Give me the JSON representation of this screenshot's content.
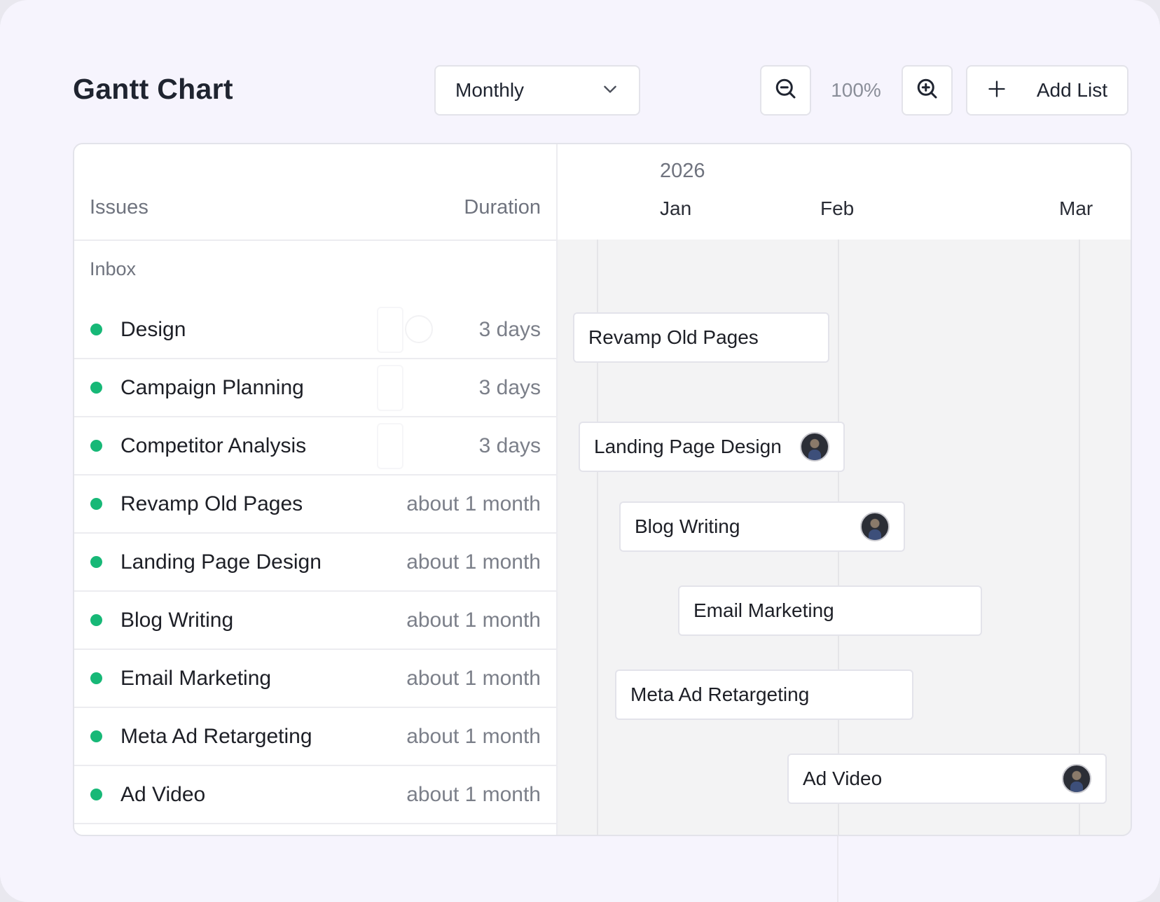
{
  "header": {
    "title": "Gantt Chart",
    "view_select": {
      "value": "Monthly"
    },
    "zoom": {
      "level": "100%"
    },
    "add_list_label": "Add List"
  },
  "issues_table": {
    "columns": {
      "issues": "Issues",
      "duration": "Duration"
    },
    "group": "Inbox",
    "status_color": "#17b877",
    "rows": [
      {
        "name": "Design",
        "duration": "3 days"
      },
      {
        "name": "Campaign Planning",
        "duration": "3 days"
      },
      {
        "name": "Competitor Analysis",
        "duration": "3 days"
      },
      {
        "name": "Revamp Old Pages",
        "duration": "about 1 month"
      },
      {
        "name": "Landing Page Design",
        "duration": "about 1 month"
      },
      {
        "name": "Blog Writing",
        "duration": "about 1 month"
      },
      {
        "name": "Email Marketing",
        "duration": "about 1 month"
      },
      {
        "name": "Meta Ad Retargeting",
        "duration": "about 1 month"
      },
      {
        "name": "Ad Video",
        "duration": "about 1 month"
      }
    ]
  },
  "timeline": {
    "year": "2026",
    "months": [
      "Jan",
      "Feb",
      "Mar"
    ],
    "bars": [
      {
        "label": "Revamp Old Pages",
        "has_avatar": false
      },
      {
        "label": "Landing Page Design",
        "has_avatar": true
      },
      {
        "label": "Blog Writing",
        "has_avatar": true
      },
      {
        "label": "Email Marketing",
        "has_avatar": false
      },
      {
        "label": "Meta Ad Retargeting",
        "has_avatar": false
      },
      {
        "label": "Ad Video",
        "has_avatar": true
      }
    ]
  }
}
